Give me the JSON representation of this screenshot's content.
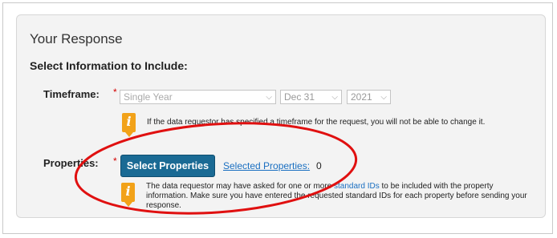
{
  "panel": {
    "title": "Your Response",
    "subtitle": "Select Information to Include:"
  },
  "timeframe": {
    "label": "Timeframe:",
    "required_mark": "*",
    "period_value": "Single Year",
    "date_value": "Dec 31",
    "year_value": "2021",
    "note": "If the data requestor has specified a timeframe for the request, you will not be able to change it."
  },
  "properties": {
    "label": "Properties:",
    "required_mark": "*",
    "select_button": "Select Properties",
    "selected_link": "Selected Properties:",
    "selected_count": "0",
    "note_part1": "The data requestor may have asked for one or more ",
    "note_link": "standard IDs",
    "note_part2": " to be included with the property information. Make sure you have entered the requested standard IDs for each property before sending your response."
  },
  "icons": {
    "info": "info-icon",
    "chevron": "chevron-down-icon"
  },
  "colors": {
    "button": "#1a6a94",
    "link": "#1a6fc1",
    "annotation": "#e01010",
    "info_icon": "#f2a219"
  }
}
